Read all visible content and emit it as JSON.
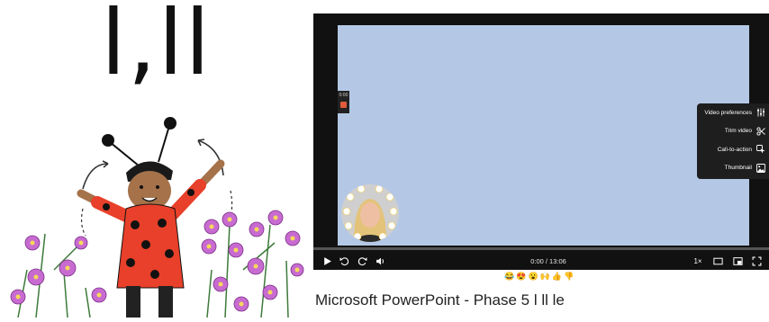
{
  "illustration": {
    "letters": "l,ll"
  },
  "player": {
    "mini_recorder_time": "0:00",
    "side_panel": [
      {
        "label": "Video preferences",
        "icon": "sliders-icon"
      },
      {
        "label": "Trim video",
        "icon": "scissors-icon"
      },
      {
        "label": "Call-to-action",
        "icon": "cursor-click-icon"
      },
      {
        "label": "Thumbnail",
        "icon": "image-icon"
      }
    ],
    "time_display": "0:00 / 13:06",
    "progress": 0,
    "speed": "1×"
  },
  "reactions": [
    "😂",
    "😍",
    "😮",
    "🙌",
    "👍",
    "👎"
  ],
  "title": "Microsoft PowerPoint - Phase 5 l ll le",
  "colors": {
    "player_bg": "#111111",
    "video_area": "#b4c8e6",
    "record_stop": "#e25b3b",
    "ladybug_red": "#e8402a"
  }
}
